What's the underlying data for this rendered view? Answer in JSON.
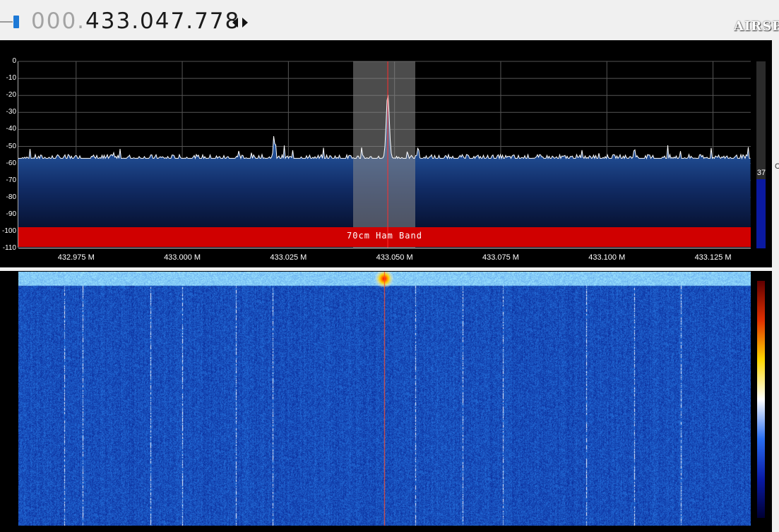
{
  "header": {
    "frequency_leading": "000.",
    "frequency_main": "433.047.778",
    "brand_text": "AIRSP"
  },
  "spectrum": {
    "db_labels": [
      "0",
      "-10",
      "-20",
      "-30",
      "-40",
      "-50",
      "-60",
      "-70",
      "-80",
      "-90",
      "-100",
      "-110"
    ],
    "freq_labels": [
      "432.975 M",
      "433.000 M",
      "433.025 M",
      "433.050 M",
      "433.075 M",
      "433.100 M",
      "433.125 M"
    ],
    "band_label": "70cm Ham Band",
    "band_color": "#d00000",
    "gain_value": "37",
    "gain_level": 0.37,
    "filter_color": "#8a8a8a",
    "tuned_line_color": "#ff3030",
    "noise_floor_db": -57,
    "peaks": [
      {
        "freq_m": 433.0484,
        "db": -19
      },
      {
        "freq_m": 433.0216,
        "db": -43
      },
      {
        "freq_m": 433.0555,
        "db": -51
      },
      {
        "freq_m": 433.1065,
        "db": -51
      }
    ]
  },
  "waterfall": {
    "palette": [
      "#000033",
      "#0a1ca8",
      "#2a6ef0",
      "#ffffff",
      "#ffd800",
      "#e03000",
      "#600000"
    ]
  },
  "side_label": "C"
}
